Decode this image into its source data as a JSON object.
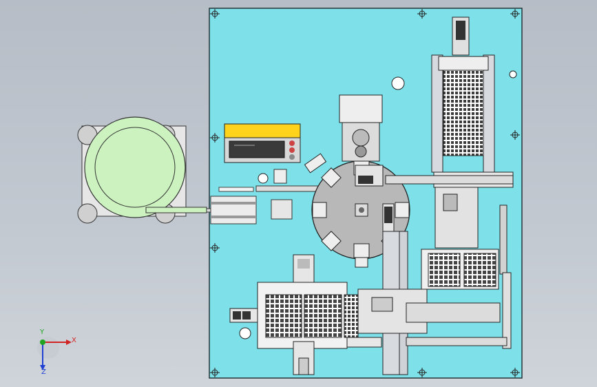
{
  "window": {
    "view": "cad-3d-viewport",
    "background_top": "#b6bdc6",
    "background_bottom": "#cfd4da"
  },
  "colors": {
    "plate": "#7ee0e8",
    "plate_edge": "#1a2a2c",
    "drum": "#cbf2bf",
    "motor_box": "#ffd21c",
    "turntable": "#b8b8b8",
    "tray": "#f2f2f2",
    "rail": "#d7dbe0"
  },
  "triad": {
    "x_label": "X",
    "y_label": "Y",
    "z_label": "Z",
    "x_color": "#d22323",
    "y_color": "#1fa51f",
    "z_color": "#1f3fd2"
  },
  "icons": {
    "coordinate_triad": "xyz-axis-triad-icon",
    "mount_hole": "crosshair-mount-hole-icon"
  }
}
